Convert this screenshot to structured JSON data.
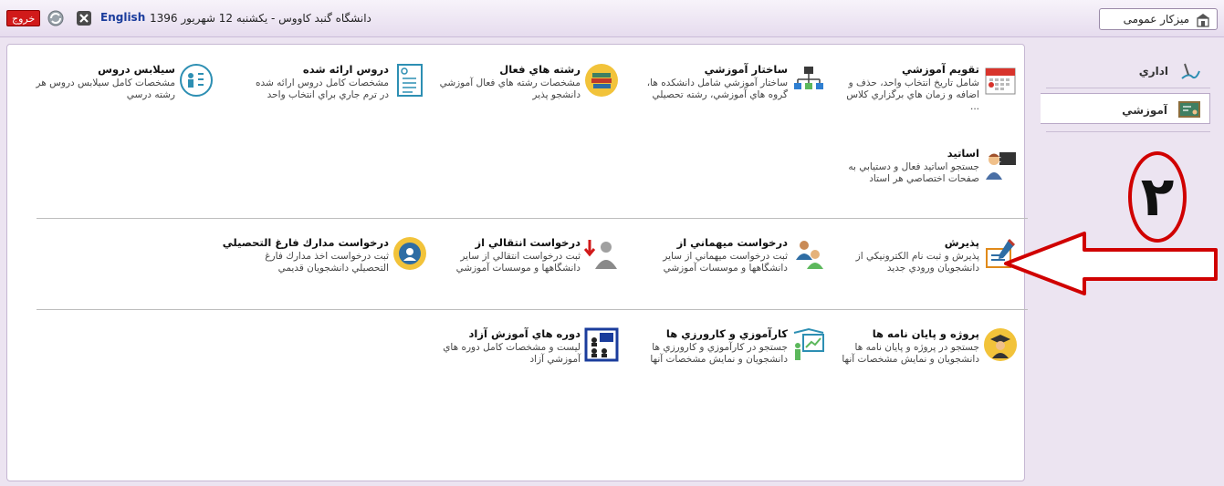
{
  "header": {
    "logout_label": "خروج",
    "language_label": "English",
    "date_text": "دانشگاه گنبد کاووس - یکشنبه 12 شهریور 1396",
    "dashboard_label": "میزکار عمومی"
  },
  "sidebar": {
    "items": [
      {
        "label": "اداري"
      },
      {
        "label": "آموزشي"
      }
    ]
  },
  "rows": [
    [
      {
        "title": "تقويم آموزشي",
        "desc": "شامل تاريخ انتخاب واحد، حذف و اضافه و زمان هاي برگزاري كلاس ...",
        "icon": "calendar-icon"
      },
      {
        "title": "ساختار آموزشي",
        "desc": "ساختار آموزشي شامل دانشكده ها، گروه هاي آموزشي، رشته تحصيلي",
        "icon": "org-chart-icon"
      },
      {
        "title": "رشته هاي فعال",
        "desc": "مشخصات رشته هاي فعال آموزشي دانشجو پذير",
        "icon": "books-icon"
      },
      {
        "title": "دروس ارائه شده",
        "desc": "مشخصات كامل دروس ارائه شده در ترم جاري براي انتخاب واحد",
        "icon": "checklist-icon"
      },
      {
        "title": "سيلابس دروس",
        "desc": "مشخصات كامل سيلابس دروس هر رشته درسي",
        "icon": "syllabus-icon"
      }
    ],
    [
      {
        "title": "اساتيد",
        "desc": "جستجو اساتيد فعال و دستيابي به صفحات اختصاصي هر استاد",
        "icon": "teacher-icon"
      }
    ],
    [
      {
        "title": "پذيرش",
        "desc": "پذيرش و ثبت نام الكترونيكي از دانشجويان ورودي جديد",
        "icon": "admission-icon"
      },
      {
        "title": "درخواست ميهماني از",
        "desc": "ثبت درخواست ميهماني از ساير دانشگاهها و موسسات آموزشي",
        "icon": "guest-request-icon"
      },
      {
        "title": "درخواست انتقالي از",
        "desc": "ثبت درخواست انتقالي از ساير دانشگاهها و موسسات آموزشي",
        "icon": "transfer-request-icon"
      },
      {
        "title": "درخواست مدارك فارغ التحصيلي",
        "desc": "ثبت درخواست اخذ مدارك فارغ التحصيلي دانشجويان قديمي",
        "icon": "graduation-icon"
      }
    ],
    [
      {
        "title": "پروژه و پايان نامه ها",
        "desc": "جستجو در پروژه و پايان نامه ها دانشجويان و نمايش مشخصات آنها",
        "icon": "graduate-icon"
      },
      {
        "title": "كارآموزي و كارورزي ها",
        "desc": "جستجو در كارآموزي و كارورزي ها دانشجويان و نمايش مشخصات آنها",
        "icon": "presentation-icon"
      },
      {
        "title": "دوره هاي آموزش آزاد",
        "desc": "ليست و مشخصات كامل دوره هاي آموزشي آزاد",
        "icon": "classroom-icon"
      }
    ]
  ],
  "annotation": {
    "number": "۲"
  },
  "colors": {
    "logout": "#d11a1a",
    "link": "#1a3c9c",
    "background": "#ece4f1",
    "annotation": "#d00000"
  }
}
